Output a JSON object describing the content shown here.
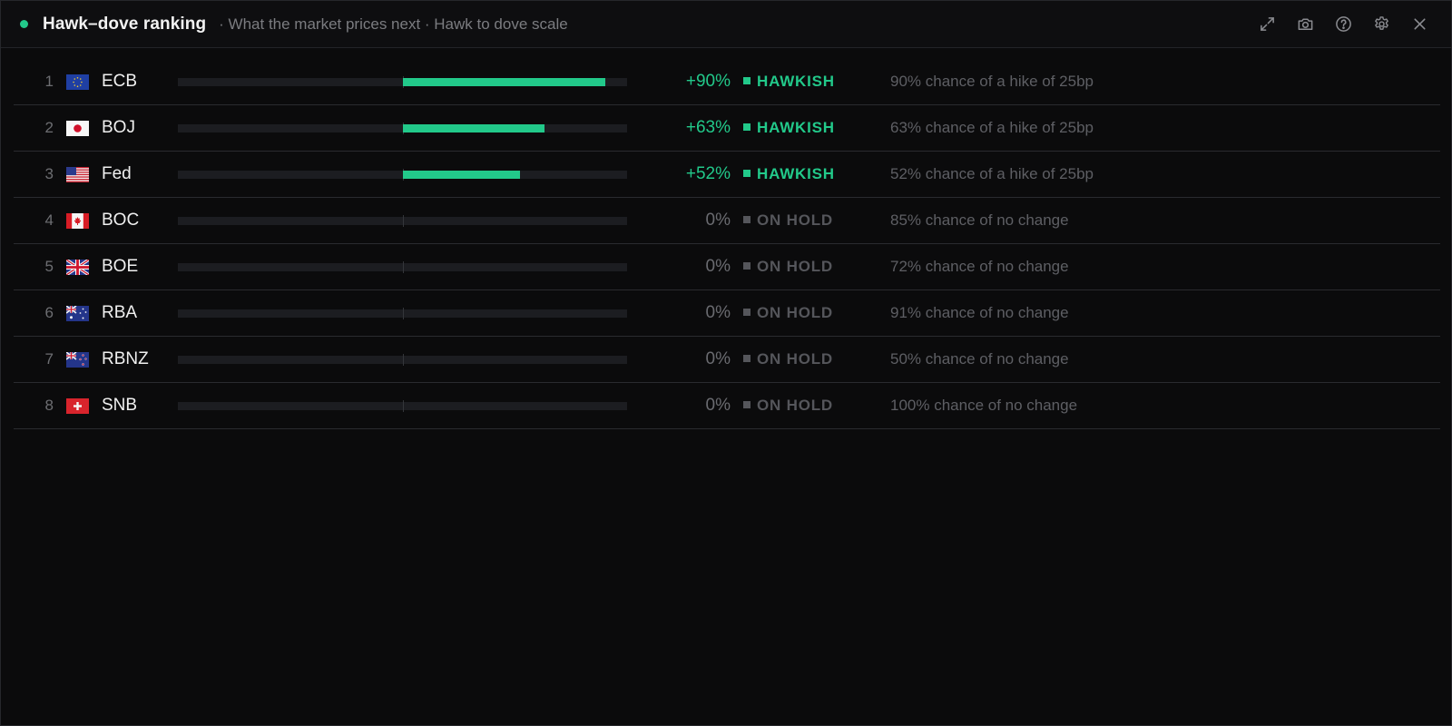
{
  "header": {
    "title": "Hawk–dove ranking",
    "subtitle": "· What the market prices next · Hawk to dove scale",
    "status_color": "#22c98a",
    "icons": [
      "expand-icon",
      "camera-icon",
      "help-icon",
      "gear-icon",
      "close-icon"
    ]
  },
  "colors": {
    "hawkish": "#22c98a",
    "on_hold": "#55565b"
  },
  "rows": [
    {
      "rank": "1",
      "flag": "eu",
      "bank": "ECB",
      "score": 0.9,
      "pct": "+90%",
      "status": "HAWKISH",
      "desc": "90% chance of a hike of 25bp"
    },
    {
      "rank": "2",
      "flag": "jp",
      "bank": "BOJ",
      "score": 0.63,
      "pct": "+63%",
      "status": "HAWKISH",
      "desc": "63% chance of a hike of 25bp"
    },
    {
      "rank": "3",
      "flag": "us",
      "bank": "Fed",
      "score": 0.52,
      "pct": "+52%",
      "status": "HAWKISH",
      "desc": "52% chance of a hike of 25bp"
    },
    {
      "rank": "4",
      "flag": "ca",
      "bank": "BOC",
      "score": 0.0,
      "pct": "0%",
      "status": "ON HOLD",
      "desc": "85% chance of no change"
    },
    {
      "rank": "5",
      "flag": "gb",
      "bank": "BOE",
      "score": 0.0,
      "pct": "0%",
      "status": "ON HOLD",
      "desc": "72% chance of no change"
    },
    {
      "rank": "6",
      "flag": "au",
      "bank": "RBA",
      "score": 0.0,
      "pct": "0%",
      "status": "ON HOLD",
      "desc": "91% chance of no change"
    },
    {
      "rank": "7",
      "flag": "nz",
      "bank": "RBNZ",
      "score": 0.0,
      "pct": "0%",
      "status": "ON HOLD",
      "desc": "50% chance of no change"
    },
    {
      "rank": "8",
      "flag": "ch",
      "bank": "SNB",
      "score": 0.0,
      "pct": "0%",
      "status": "ON HOLD",
      "desc": "100% chance of no change"
    }
  ]
}
